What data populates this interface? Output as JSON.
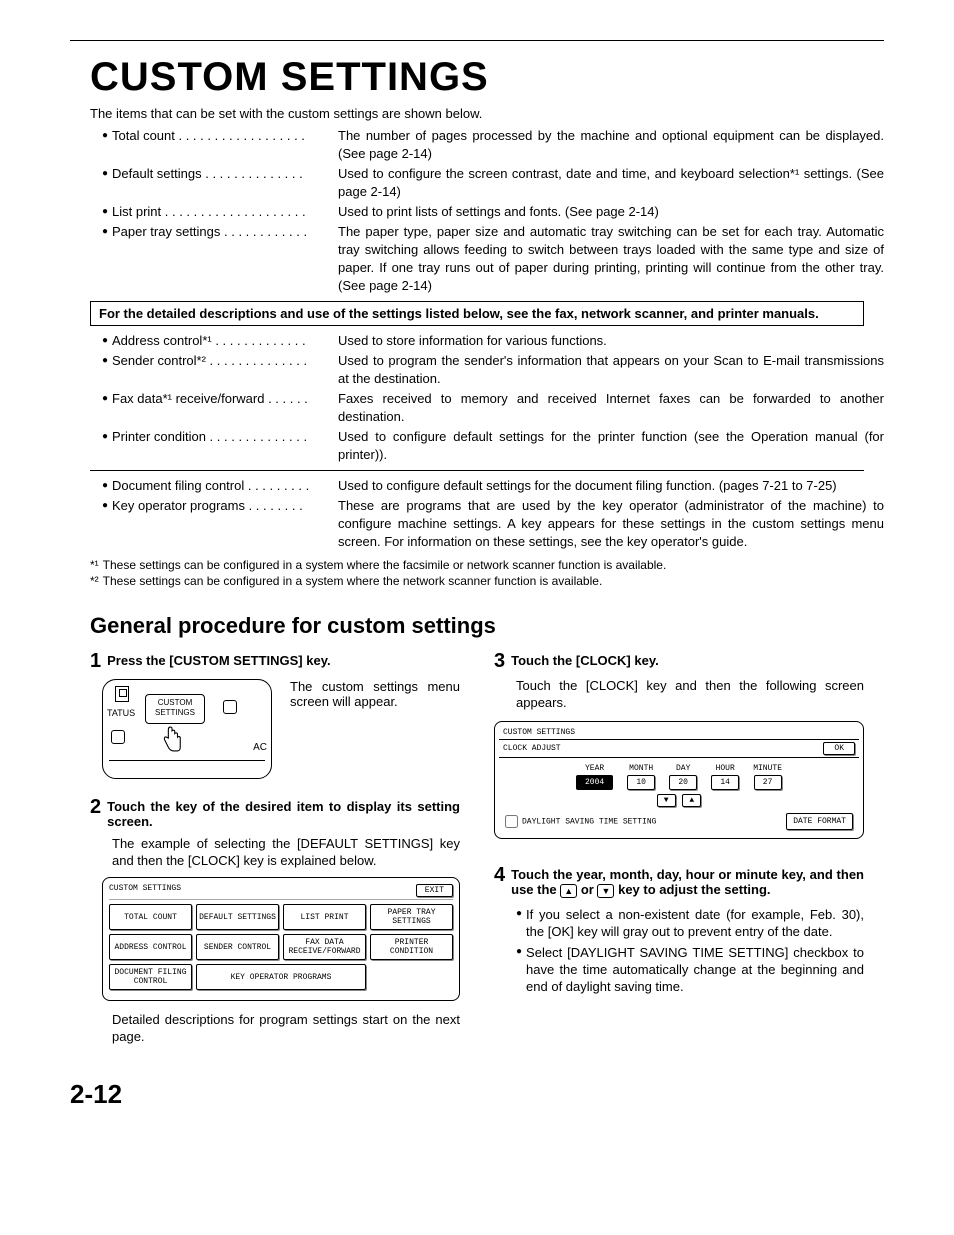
{
  "title": "CUSTOM SETTINGS",
  "intro": "The items that can be set with the custom settings are shown below.",
  "list1": [
    {
      "term": "Total count . . . . . . . . . . . . . . . . . .",
      "desc": "The number of pages processed by the machine and optional equipment can be displayed. (See page 2-14)"
    },
    {
      "term": "Default settings  . . . . . . . . . . . . . .",
      "desc": "Used to configure the screen contrast, date and time, and keyboard selection*¹ settings. (See page 2-14)"
    },
    {
      "term": "List print . . . . . . . . . . . . . . . . . . . .",
      "desc": "Used to print lists of settings and fonts. (See page 2-14)"
    },
    {
      "term": "Paper tray settings . . . . . . . . . . . .",
      "desc": "The paper type, paper size and automatic tray switching can be set for each tray. Automatic tray switching allows feeding to switch between trays loaded with the same type and size of paper. If one tray runs out of paper during printing, printing will continue from the other tray. (See page 2-14)"
    }
  ],
  "boxnote": "For the detailed descriptions and use of the settings listed below, see the fax, network scanner, and printer manuals.",
  "list2": [
    {
      "term": "Address control*¹ . . . . . . . . . . . . .",
      "desc": "Used to store information for various functions."
    },
    {
      "term": "Sender control*² . . . . . . . . . . . . . .",
      "desc": "Used to program the sender's information that appears on your Scan to E-mail transmissions at the destination."
    },
    {
      "term": "Fax data*¹ receive/forward . . . . . .",
      "desc": "Faxes received to memory and received Internet faxes can be forwarded to another destination."
    },
    {
      "term": "Printer condition . . . . . . . . . . . . . .",
      "desc": "Used to configure default settings for the printer function (see the Operation manual (for printer))."
    }
  ],
  "list3": [
    {
      "term": "Document filing control . . . . . . . . .",
      "desc": "Used to configure default settings for the document filing function. (pages 7-21 to 7-25)"
    },
    {
      "term": "Key operator programs  . . . . . . . .",
      "desc": "These are programs that are used by the key operator (administrator of the machine) to configure machine settings. A key appears for these settings in the custom settings menu screen. For information on these settings, see the key operator's guide."
    }
  ],
  "fn1": "These settings can be configured in a system where the facsimile or network scanner function is available.",
  "fn2": "These settings can be configured in a system where the network scanner function is available.",
  "h2": "General procedure for custom settings",
  "step1": {
    "title": "Press the [CUSTOM SETTINGS] key.",
    "body": "The custom settings menu screen will appear."
  },
  "panel1": {
    "status": "TATUS",
    "btn": "CUSTOM SETTINGS",
    "ac": "AC"
  },
  "step2": {
    "title": "Touch the key of the desired item to display its setting screen.",
    "body": "The example of selecting the [DEFAULT SETTINGS] key and then the [CLOCK] key is explained below.",
    "after": "Detailed descriptions for program settings start on the next page."
  },
  "screen1": {
    "title": "CUSTOM SETTINGS",
    "exit": "EXIT",
    "cells": [
      "TOTAL COUNT",
      "DEFAULT SETTINGS",
      "LIST PRINT",
      "PAPER TRAY SETTINGS",
      "ADDRESS CONTROL",
      "SENDER CONTROL",
      "FAX DATA RECEIVE/FORWARD",
      "PRINTER CONDITION",
      "DOCUMENT FILING CONTROL",
      "KEY OPERATOR PROGRAMS"
    ]
  },
  "step3": {
    "title": "Touch the [CLOCK] key.",
    "body": "Touch the [CLOCK] key and then the following screen appears."
  },
  "screen2": {
    "top": "CUSTOM SETTINGS",
    "sub": "CLOCK ADJUST",
    "ok": "OK",
    "heads": [
      "YEAR",
      "MONTH",
      "DAY",
      "HOUR",
      "MINUTE"
    ],
    "vals": [
      "2004",
      "10",
      "20",
      "14",
      "27"
    ],
    "dst": "DAYLIGHT SAVING TIME SETTING",
    "df": "DATE FORMAT"
  },
  "step4": {
    "title_a": "Touch the year, month, day, hour or minute key, and then use the ",
    "title_b": " or ",
    "title_c": " key to adjust the setting.",
    "b1": "If you select a non-existent date (for example, Feb. 30), the [OK] key will gray out to prevent entry of the date.",
    "b2": "Select [DAYLIGHT SAVING TIME SETTING] checkbox to have the time automatically change at the beginning and end of daylight saving time."
  },
  "pagenum": "2-12"
}
